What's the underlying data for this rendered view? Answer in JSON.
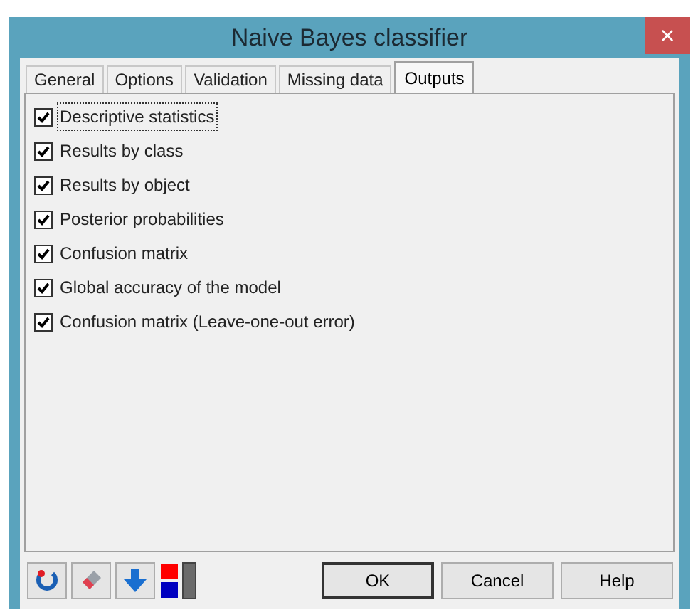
{
  "window": {
    "title": "Naive Bayes classifier",
    "close": "×"
  },
  "tabs": [
    {
      "label": "General",
      "selected": false
    },
    {
      "label": "Options",
      "selected": false
    },
    {
      "label": "Validation",
      "selected": false
    },
    {
      "label": "Missing data",
      "selected": false
    },
    {
      "label": "Outputs",
      "selected": true
    }
  ],
  "options": [
    {
      "label": "Descriptive statistics",
      "checked": true,
      "focused": true
    },
    {
      "label": "Results by class",
      "checked": true,
      "focused": false
    },
    {
      "label": "Results by object",
      "checked": true,
      "focused": false
    },
    {
      "label": "Posterior probabilities",
      "checked": true,
      "focused": false
    },
    {
      "label": "Confusion matrix",
      "checked": true,
      "focused": false
    },
    {
      "label": "Global accuracy of the model",
      "checked": true,
      "focused": false
    },
    {
      "label": "Confusion matrix (Leave-one-out error)",
      "checked": true,
      "focused": false
    }
  ],
  "buttons": [
    "OK",
    "Cancel",
    "Help"
  ]
}
